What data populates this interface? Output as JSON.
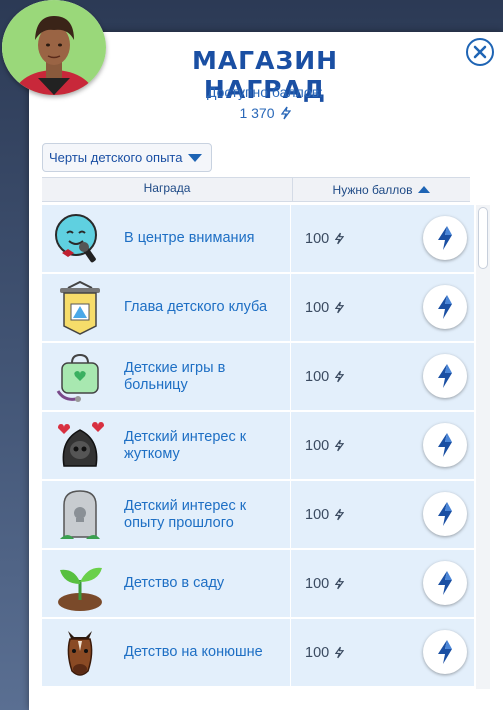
{
  "dialog": {
    "title": "МАГАЗИН НАГРАД",
    "points_label": "Доступно баллов:",
    "points_value": "1 370"
  },
  "filter": {
    "selected": "Черты детского опыта"
  },
  "table": {
    "col_reward": "Награда",
    "col_cost": "Нужно баллов"
  },
  "rewards": [
    {
      "name": "В центре внимания",
      "cost": "100",
      "icon": "spotlight-face-icon"
    },
    {
      "name": "Глава детского клуба",
      "cost": "100",
      "icon": "club-banner-icon"
    },
    {
      "name": "Детские игры в больницу",
      "cost": "100",
      "icon": "stethoscope-bag-icon"
    },
    {
      "name": "Детский интерес к жуткому",
      "cost": "100",
      "icon": "spooky-skull-icon"
    },
    {
      "name": "Детский интерес к опыту прошлого",
      "cost": "100",
      "icon": "tombstone-icon"
    },
    {
      "name": "Детство в саду",
      "cost": "100",
      "icon": "sprout-icon"
    },
    {
      "name": "Детство на конюшне",
      "cost": "100",
      "icon": "horse-head-icon"
    }
  ],
  "colors": {
    "accent": "#1a4fa3",
    "row_bg": "#e3effb",
    "link_text": "#1e6fc4"
  }
}
